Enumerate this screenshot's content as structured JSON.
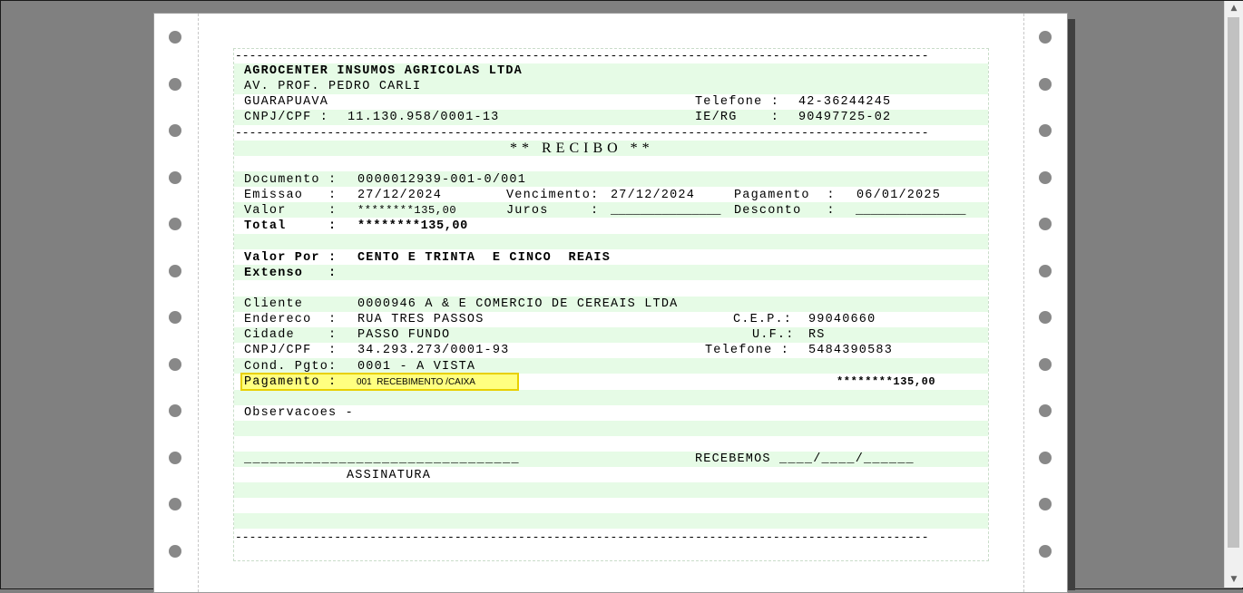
{
  "company": {
    "name": "AGROCENTER INSUMOS AGRICOLAS LTDA",
    "address": "AV. PROF. PEDRO CARLI",
    "city": "GUARAPUAVA",
    "phone_label": "Telefone :",
    "phone": "42-36244245",
    "cnpj_label": "CNPJ/CPF :",
    "cnpj": "11.130.958/0001-13",
    "ie_label": "IE/RG    :",
    "ie": "90497725-02"
  },
  "separator": "--------------------------------------------------------------------------------------------------",
  "title": "** RECIBO **",
  "document": {
    "doc_label": "Documento :",
    "doc": "0000012939-001-0/001",
    "emissao_label": "Emissao   :",
    "emissao": "27/12/2024",
    "venc_label": "Vencimento:",
    "venc": "27/12/2024",
    "pag_label": "Pagamento  :",
    "pag": "06/01/2025",
    "valor_label": "Valor     :",
    "valor": "********135,00",
    "juros_label": "Juros     :",
    "juros_blank": "_______________",
    "desconto_label": "Desconto   :",
    "desconto_blank": "_______________",
    "total_label": "Total     :",
    "total": "********135,00"
  },
  "extenso": {
    "label1": "Valor Por :",
    "value": "CENTO E TRINTA  E CINCO  REAIS",
    "label2": "Extenso   :"
  },
  "client": {
    "cliente_label": "Cliente",
    "cliente": "0000946 A & E COMERCIO DE CEREAIS LTDA",
    "endereco_label": "Endereco  :",
    "endereco": "RUA TRES PASSOS",
    "cep_label": "C.E.P.:",
    "cep": "99040660",
    "cidade_label": "Cidade    :",
    "cidade": "PASSO FUNDO",
    "uf_label": "U.F.:",
    "uf": "RS",
    "cnpj_label": "CNPJ/CPF  :",
    "cnpj": "34.293.273/0001-93",
    "tel_label": "Telefone :",
    "tel": "5484390583",
    "cond_label": "Cond. Pgto:",
    "cond": "0001 - A VISTA",
    "pagamento_label": "Pagamento :",
    "pagamento": "001  RECEBIMENTO /CAIXA",
    "pagamento_value": "********135,00"
  },
  "observacoes": "Observacoes -",
  "signature": {
    "line": "________________________________",
    "recebemos": "RECEBEMOS ____/____/______",
    "assinatura": "ASSINATURA"
  }
}
